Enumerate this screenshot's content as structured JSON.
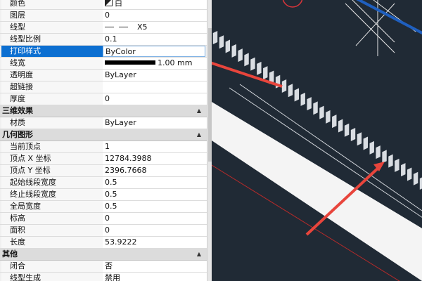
{
  "general_rows": [
    {
      "label": "颜色",
      "value": "白",
      "swatch": true
    },
    {
      "label": "图层",
      "value": "0"
    },
    {
      "label": "线型",
      "value": "X5",
      "linetype": true
    },
    {
      "label": "线型比例",
      "value": "0.1"
    },
    {
      "label": "打印样式",
      "value": "ByColor",
      "selected": true
    },
    {
      "label": "线宽",
      "value": "1.00 mm",
      "lineweight": true
    },
    {
      "label": "透明度",
      "value": "ByLayer"
    },
    {
      "label": "超链接",
      "value": ""
    },
    {
      "label": "厚度",
      "value": "0"
    }
  ],
  "sections": {
    "three_d": "三维效果",
    "geometry": "几何图形",
    "misc": "其他"
  },
  "three_d_rows": [
    {
      "label": "材质",
      "value": "ByLayer"
    }
  ],
  "geometry_rows": [
    {
      "label": "当前顶点",
      "value": "1"
    },
    {
      "label": "顶点 X 坐标",
      "value": "12784.3988"
    },
    {
      "label": "顶点 Y 坐标",
      "value": "2396.7668"
    },
    {
      "label": "起始线段宽度",
      "value": "0.5"
    },
    {
      "label": "终止线段宽度",
      "value": "0.5"
    },
    {
      "label": "全局宽度",
      "value": "0.5"
    },
    {
      "label": "标高",
      "value": "0"
    },
    {
      "label": "面积",
      "value": "0"
    },
    {
      "label": "长度",
      "value": "53.9222"
    }
  ],
  "misc_rows": [
    {
      "label": "闭合",
      "value": "否"
    },
    {
      "label": "线型生成",
      "value": "禁用"
    }
  ],
  "colors": {
    "selection": "#0c6fd1",
    "canvas_bg": "#202a35",
    "annotation_arrow": "#e8453c",
    "axis_blue": "#1f5fbf"
  }
}
